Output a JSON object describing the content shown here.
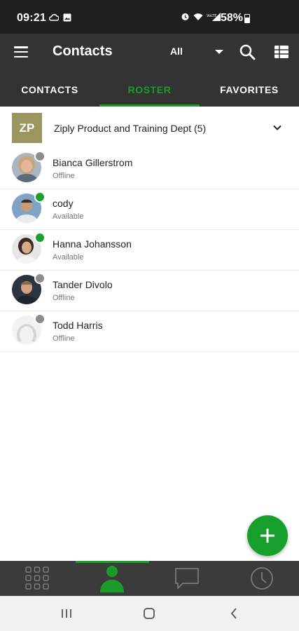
{
  "status_bar": {
    "time": "09:21",
    "battery": "58%"
  },
  "app_bar": {
    "title": "Contacts",
    "filter_value": "All"
  },
  "tabs": [
    {
      "label": "CONTACTS"
    },
    {
      "label": "ROSTER"
    },
    {
      "label": "FAVORITES"
    }
  ],
  "group": {
    "initials": "ZP",
    "name": "Ziply Product and Training Dept (5)"
  },
  "contacts": [
    {
      "name": "Bianca Gillerstrom",
      "status": "Offline"
    },
    {
      "name": "cody",
      "status": "Available"
    },
    {
      "name": "Hanna Johansson",
      "status": "Available"
    },
    {
      "name": "Tander Divolo",
      "status": "Offline"
    },
    {
      "name": "Todd Harris",
      "status": "Offline"
    }
  ],
  "colors": {
    "accent": "#1a9b2a",
    "fab": "#16a02b",
    "app_bar": "#333333",
    "group_avatar": "#9b9560",
    "presence_online": "#1aa02e",
    "presence_offline": "#8c8c8c"
  },
  "icons": {
    "menu": "menu-icon",
    "search": "search-icon",
    "grid_view": "grid-view-icon",
    "dialpad": "dialpad-icon",
    "person": "person-icon",
    "chat": "chat-icon",
    "history": "clock-icon",
    "add": "plus-icon"
  }
}
